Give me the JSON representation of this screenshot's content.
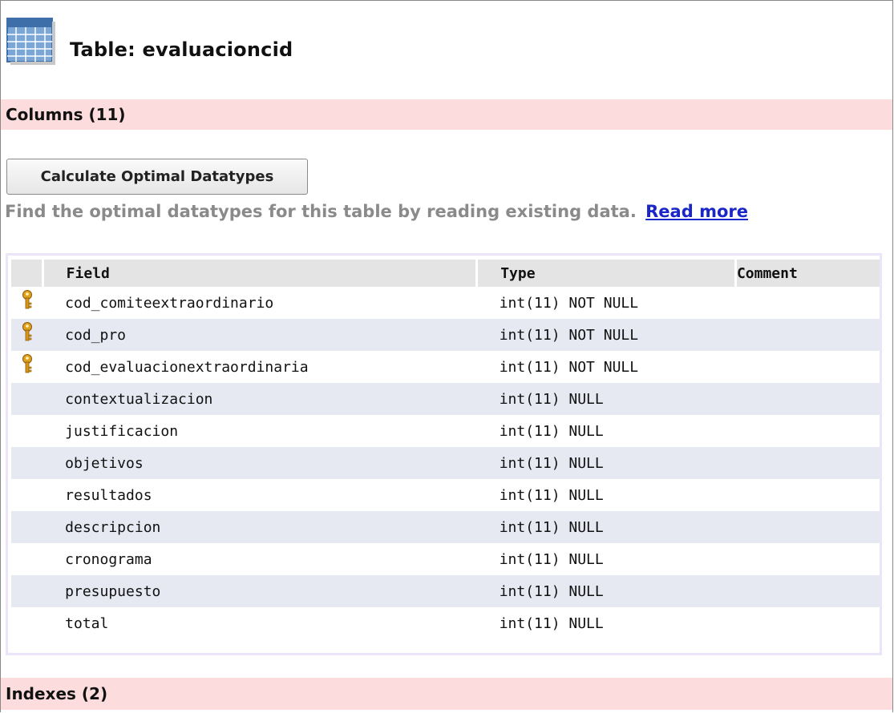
{
  "page": {
    "title": "Table: evaluacioncid"
  },
  "columns_section": {
    "heading": "Columns (11)",
    "calc_button_label": "Calculate Optimal Datatypes",
    "hint_text": "Find the optimal datatypes for this table by reading existing data.",
    "read_more_label": "Read more"
  },
  "table": {
    "headers": {
      "field": "Field",
      "type": "Type",
      "comment": "Comment"
    },
    "rows": [
      {
        "key": true,
        "field": "cod_comiteextraordinario",
        "type": "int(11) NOT NULL",
        "comment": ""
      },
      {
        "key": true,
        "field": "cod_pro",
        "type": "int(11) NOT NULL",
        "comment": ""
      },
      {
        "key": true,
        "field": "cod_evaluacionextraordinaria",
        "type": "int(11) NOT NULL",
        "comment": ""
      },
      {
        "key": false,
        "field": "contextualizacion",
        "type": "int(11) NULL",
        "comment": ""
      },
      {
        "key": false,
        "field": "justificacion",
        "type": "int(11) NULL",
        "comment": ""
      },
      {
        "key": false,
        "field": "objetivos",
        "type": "int(11) NULL",
        "comment": ""
      },
      {
        "key": false,
        "field": "resultados",
        "type": "int(11) NULL",
        "comment": ""
      },
      {
        "key": false,
        "field": "descripcion",
        "type": "int(11) NULL",
        "comment": ""
      },
      {
        "key": false,
        "field": "cronograma",
        "type": "int(11) NULL",
        "comment": ""
      },
      {
        "key": false,
        "field": "presupuesto",
        "type": "int(11) NULL",
        "comment": ""
      },
      {
        "key": false,
        "field": "total",
        "type": "int(11) NULL",
        "comment": ""
      }
    ]
  },
  "indexes_section": {
    "heading": "Indexes (2)"
  },
  "icons": {
    "table": "table-grid-icon",
    "primary_key": "key-icon"
  },
  "colors": {
    "section_bar": "#fcdcdc",
    "link": "#1a26c8",
    "alt_row": "#e6e9f2",
    "header_row": "#e4e4e4"
  }
}
